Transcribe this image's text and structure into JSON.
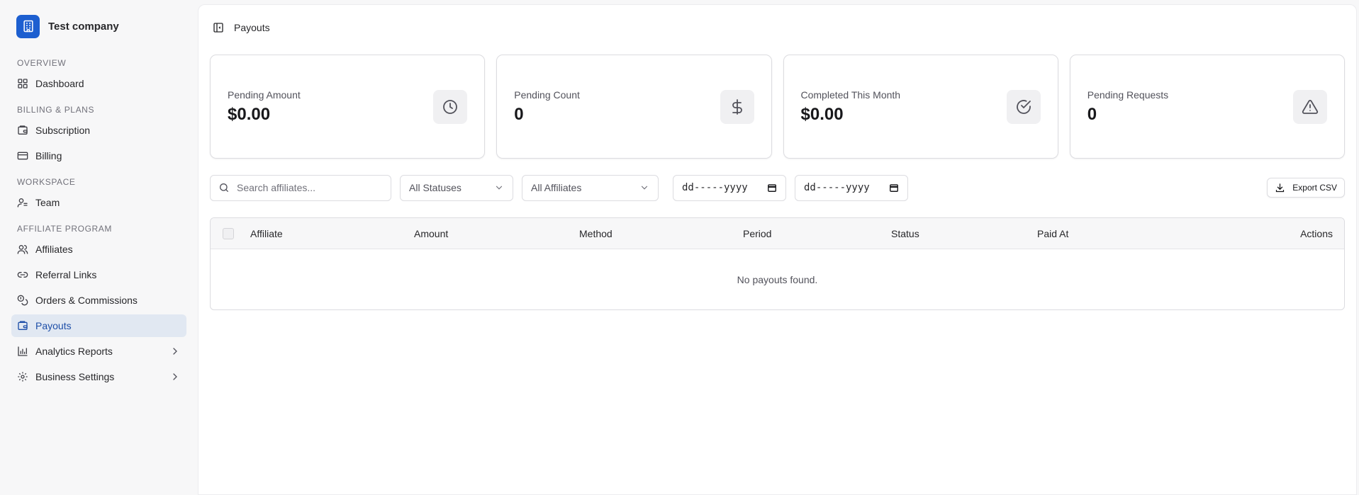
{
  "company": {
    "name": "Test company"
  },
  "nav": {
    "overview": {
      "label": "OVERVIEW",
      "items": [
        {
          "label": "Dashboard"
        }
      ]
    },
    "billing": {
      "label": "BILLING & PLANS",
      "items": [
        {
          "label": "Subscription"
        },
        {
          "label": "Billing"
        }
      ]
    },
    "workspace": {
      "label": "WORKSPACE",
      "items": [
        {
          "label": "Team"
        }
      ]
    },
    "affiliate": {
      "label": "AFFILIATE PROGRAM",
      "items": [
        {
          "label": "Affiliates"
        },
        {
          "label": "Referral Links"
        },
        {
          "label": "Orders & Commissions"
        },
        {
          "label": "Payouts"
        },
        {
          "label": "Analytics Reports"
        },
        {
          "label": "Business Settings"
        }
      ]
    }
  },
  "page": {
    "title": "Payouts"
  },
  "stats": [
    {
      "label": "Pending Amount",
      "value": "$0.00",
      "icon": "clock-icon"
    },
    {
      "label": "Pending Count",
      "value": "0",
      "icon": "dollar-icon"
    },
    {
      "label": "Completed This Month",
      "value": "$0.00",
      "icon": "check-circle-icon"
    },
    {
      "label": "Pending Requests",
      "value": "0",
      "icon": "alert-triangle-icon"
    }
  ],
  "filters": {
    "search_placeholder": "Search affiliates...",
    "status_selected": "All Statuses",
    "affiliate_selected": "All Affiliates",
    "date_from": "dd-----yyyy",
    "date_to": "dd-----yyyy",
    "export_label": "Export CSV"
  },
  "table": {
    "columns": [
      "Affiliate",
      "Amount",
      "Method",
      "Period",
      "Status",
      "Paid At",
      "Actions"
    ],
    "empty_message": "No payouts found."
  },
  "colors": {
    "brand": "#1d5fd0",
    "active_nav_bg": "#e1e8f2",
    "active_nav_text": "#1d4ea8"
  }
}
